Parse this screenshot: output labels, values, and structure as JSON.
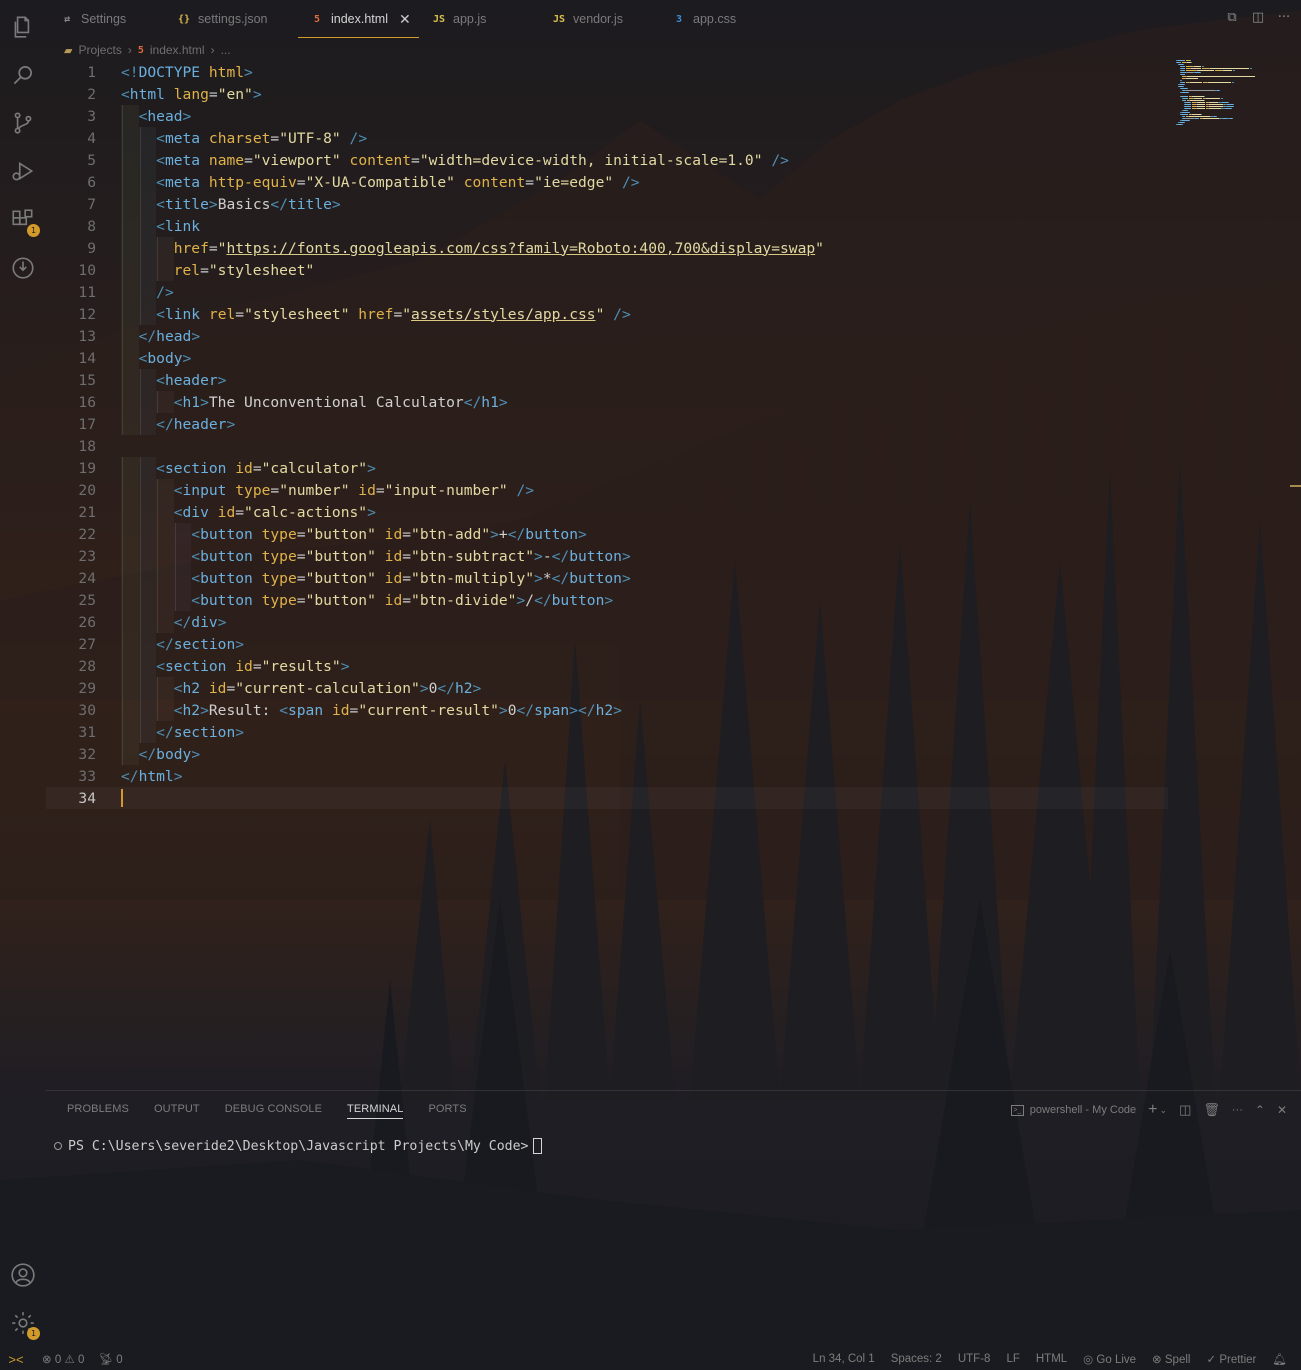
{
  "tabs": [
    {
      "icon": "⇄",
      "label": "Settings",
      "active": false
    },
    {
      "icon": "{}",
      "label": "settings.json",
      "active": false
    },
    {
      "icon": "5",
      "label": "index.html",
      "active": true
    },
    {
      "icon": "JS",
      "label": "app.js",
      "active": false
    },
    {
      "icon": "JS",
      "label": "vendor.js",
      "active": false
    },
    {
      "icon": "3",
      "label": "app.css",
      "active": false
    }
  ],
  "tab_close_glyph": "✕",
  "top_actions": [
    "⧉",
    "◫",
    "···"
  ],
  "breadcrumb": {
    "folder": "Projects",
    "sep": "›",
    "file": "index.html",
    "sep2": "›",
    "more": "..."
  },
  "code_lines": [
    {
      "n": "1",
      "c": [
        [
          "p",
          "<!"
        ],
        [
          "t",
          "DOCTYPE"
        ],
        [
          "x",
          " "
        ],
        [
          "a",
          "html"
        ],
        [
          "p",
          ">"
        ]
      ]
    },
    {
      "n": "2",
      "c": [
        [
          "p",
          "<"
        ],
        [
          "t",
          "html"
        ],
        [
          "x",
          " "
        ],
        [
          "a",
          "lang"
        ],
        [
          "x",
          "="
        ],
        [
          "s",
          "\"en\""
        ],
        [
          "p",
          ">"
        ]
      ]
    },
    {
      "n": "3",
      "c": [
        [
          "x",
          "  "
        ],
        [
          "p",
          "<"
        ],
        [
          "t",
          "head"
        ],
        [
          "p",
          ">"
        ]
      ]
    },
    {
      "n": "4",
      "c": [
        [
          "x",
          "    "
        ],
        [
          "p",
          "<"
        ],
        [
          "t",
          "meta"
        ],
        [
          "x",
          " "
        ],
        [
          "a",
          "charset"
        ],
        [
          "x",
          "="
        ],
        [
          "s",
          "\"UTF-8\""
        ],
        [
          "x",
          " "
        ],
        [
          "p",
          "/>"
        ]
      ]
    },
    {
      "n": "5",
      "c": [
        [
          "x",
          "    "
        ],
        [
          "p",
          "<"
        ],
        [
          "t",
          "meta"
        ],
        [
          "x",
          " "
        ],
        [
          "a",
          "name"
        ],
        [
          "x",
          "="
        ],
        [
          "s",
          "\"viewport\""
        ],
        [
          "x",
          " "
        ],
        [
          "a",
          "content"
        ],
        [
          "x",
          "="
        ],
        [
          "s",
          "\"width=device-width, initial-scale=1.0\""
        ],
        [
          "x",
          " "
        ],
        [
          "p",
          "/>"
        ]
      ]
    },
    {
      "n": "6",
      "c": [
        [
          "x",
          "    "
        ],
        [
          "p",
          "<"
        ],
        [
          "t",
          "meta"
        ],
        [
          "x",
          " "
        ],
        [
          "a",
          "http-equiv"
        ],
        [
          "x",
          "="
        ],
        [
          "s",
          "\"X-UA-Compatible\""
        ],
        [
          "x",
          " "
        ],
        [
          "a",
          "content"
        ],
        [
          "x",
          "="
        ],
        [
          "s",
          "\"ie=edge\""
        ],
        [
          "x",
          " "
        ],
        [
          "p",
          "/>"
        ]
      ]
    },
    {
      "n": "7",
      "c": [
        [
          "x",
          "    "
        ],
        [
          "p",
          "<"
        ],
        [
          "t",
          "title"
        ],
        [
          "p",
          ">"
        ],
        [
          "x",
          "Basics"
        ],
        [
          "p",
          "</"
        ],
        [
          "t",
          "title"
        ],
        [
          "p",
          ">"
        ]
      ]
    },
    {
      "n": "8",
      "c": [
        [
          "x",
          "    "
        ],
        [
          "p",
          "<"
        ],
        [
          "t",
          "link"
        ]
      ]
    },
    {
      "n": "9",
      "c": [
        [
          "x",
          "      "
        ],
        [
          "a",
          "href"
        ],
        [
          "x",
          "="
        ],
        [
          "s",
          "\""
        ],
        [
          "su",
          "https://fonts.googleapis.com/css?family=Roboto:400,700&display=swap"
        ],
        [
          "s",
          "\""
        ]
      ]
    },
    {
      "n": "10",
      "c": [
        [
          "x",
          "      "
        ],
        [
          "a",
          "rel"
        ],
        [
          "x",
          "="
        ],
        [
          "s",
          "\"stylesheet\""
        ]
      ]
    },
    {
      "n": "11",
      "c": [
        [
          "x",
          "    "
        ],
        [
          "p",
          "/>"
        ]
      ]
    },
    {
      "n": "12",
      "c": [
        [
          "x",
          "    "
        ],
        [
          "p",
          "<"
        ],
        [
          "t",
          "link"
        ],
        [
          "x",
          " "
        ],
        [
          "a",
          "rel"
        ],
        [
          "x",
          "="
        ],
        [
          "s",
          "\"stylesheet\""
        ],
        [
          "x",
          " "
        ],
        [
          "a",
          "href"
        ],
        [
          "x",
          "="
        ],
        [
          "s",
          "\""
        ],
        [
          "su",
          "assets/styles/app.css"
        ],
        [
          "s",
          "\""
        ],
        [
          "x",
          " "
        ],
        [
          "p",
          "/>"
        ]
      ]
    },
    {
      "n": "13",
      "c": [
        [
          "x",
          "  "
        ],
        [
          "p",
          "</"
        ],
        [
          "t",
          "head"
        ],
        [
          "p",
          ">"
        ]
      ]
    },
    {
      "n": "14",
      "c": [
        [
          "x",
          "  "
        ],
        [
          "p",
          "<"
        ],
        [
          "t",
          "body"
        ],
        [
          "p",
          ">"
        ]
      ]
    },
    {
      "n": "15",
      "c": [
        [
          "x",
          "    "
        ],
        [
          "p",
          "<"
        ],
        [
          "t",
          "header"
        ],
        [
          "p",
          ">"
        ]
      ]
    },
    {
      "n": "16",
      "c": [
        [
          "x",
          "      "
        ],
        [
          "p",
          "<"
        ],
        [
          "t",
          "h1"
        ],
        [
          "p",
          ">"
        ],
        [
          "x",
          "The Unconventional Calculator"
        ],
        [
          "p",
          "</"
        ],
        [
          "t",
          "h1"
        ],
        [
          "p",
          ">"
        ]
      ]
    },
    {
      "n": "17",
      "c": [
        [
          "x",
          "    "
        ],
        [
          "p",
          "</"
        ],
        [
          "t",
          "header"
        ],
        [
          "p",
          ">"
        ]
      ]
    },
    {
      "n": "18",
      "c": []
    },
    {
      "n": "19",
      "c": [
        [
          "x",
          "    "
        ],
        [
          "p",
          "<"
        ],
        [
          "t",
          "section"
        ],
        [
          "x",
          " "
        ],
        [
          "a",
          "id"
        ],
        [
          "x",
          "="
        ],
        [
          "s",
          "\"calculator\""
        ],
        [
          "p",
          ">"
        ]
      ]
    },
    {
      "n": "20",
      "c": [
        [
          "x",
          "      "
        ],
        [
          "p",
          "<"
        ],
        [
          "t",
          "input"
        ],
        [
          "x",
          " "
        ],
        [
          "a",
          "type"
        ],
        [
          "x",
          "="
        ],
        [
          "s",
          "\"number\""
        ],
        [
          "x",
          " "
        ],
        [
          "a",
          "id"
        ],
        [
          "x",
          "="
        ],
        [
          "s",
          "\"input-number\""
        ],
        [
          "x",
          " "
        ],
        [
          "p",
          "/>"
        ]
      ]
    },
    {
      "n": "21",
      "c": [
        [
          "x",
          "      "
        ],
        [
          "p",
          "<"
        ],
        [
          "t",
          "div"
        ],
        [
          "x",
          " "
        ],
        [
          "a",
          "id"
        ],
        [
          "x",
          "="
        ],
        [
          "s",
          "\"calc-actions\""
        ],
        [
          "p",
          ">"
        ]
      ]
    },
    {
      "n": "22",
      "c": [
        [
          "x",
          "        "
        ],
        [
          "p",
          "<"
        ],
        [
          "t",
          "button"
        ],
        [
          "x",
          " "
        ],
        [
          "a",
          "type"
        ],
        [
          "x",
          "="
        ],
        [
          "s",
          "\"button\""
        ],
        [
          "x",
          " "
        ],
        [
          "a",
          "id"
        ],
        [
          "x",
          "="
        ],
        [
          "s",
          "\"btn-add\""
        ],
        [
          "p",
          ">"
        ],
        [
          "x",
          "+"
        ],
        [
          "p",
          "</"
        ],
        [
          "t",
          "button"
        ],
        [
          "p",
          ">"
        ]
      ]
    },
    {
      "n": "23",
      "c": [
        [
          "x",
          "        "
        ],
        [
          "p",
          "<"
        ],
        [
          "t",
          "button"
        ],
        [
          "x",
          " "
        ],
        [
          "a",
          "type"
        ],
        [
          "x",
          "="
        ],
        [
          "s",
          "\"button\""
        ],
        [
          "x",
          " "
        ],
        [
          "a",
          "id"
        ],
        [
          "x",
          "="
        ],
        [
          "s",
          "\"btn-subtract\""
        ],
        [
          "p",
          ">"
        ],
        [
          "x",
          "-"
        ],
        [
          "p",
          "</"
        ],
        [
          "t",
          "button"
        ],
        [
          "p",
          ">"
        ]
      ]
    },
    {
      "n": "24",
      "c": [
        [
          "x",
          "        "
        ],
        [
          "p",
          "<"
        ],
        [
          "t",
          "button"
        ],
        [
          "x",
          " "
        ],
        [
          "a",
          "type"
        ],
        [
          "x",
          "="
        ],
        [
          "s",
          "\"button\""
        ],
        [
          "x",
          " "
        ],
        [
          "a",
          "id"
        ],
        [
          "x",
          "="
        ],
        [
          "s",
          "\"btn-multiply\""
        ],
        [
          "p",
          ">"
        ],
        [
          "x",
          "*"
        ],
        [
          "p",
          "</"
        ],
        [
          "t",
          "button"
        ],
        [
          "p",
          ">"
        ]
      ]
    },
    {
      "n": "25",
      "c": [
        [
          "x",
          "        "
        ],
        [
          "p",
          "<"
        ],
        [
          "t",
          "button"
        ],
        [
          "x",
          " "
        ],
        [
          "a",
          "type"
        ],
        [
          "x",
          "="
        ],
        [
          "s",
          "\"button\""
        ],
        [
          "x",
          " "
        ],
        [
          "a",
          "id"
        ],
        [
          "x",
          "="
        ],
        [
          "s",
          "\"btn-divide\""
        ],
        [
          "p",
          ">"
        ],
        [
          "x",
          "/"
        ],
        [
          "p",
          "</"
        ],
        [
          "t",
          "button"
        ],
        [
          "p",
          ">"
        ]
      ]
    },
    {
      "n": "26",
      "c": [
        [
          "x",
          "      "
        ],
        [
          "p",
          "</"
        ],
        [
          "t",
          "div"
        ],
        [
          "p",
          ">"
        ]
      ]
    },
    {
      "n": "27",
      "c": [
        [
          "x",
          "    "
        ],
        [
          "p",
          "</"
        ],
        [
          "t",
          "section"
        ],
        [
          "p",
          ">"
        ]
      ]
    },
    {
      "n": "28",
      "c": [
        [
          "x",
          "    "
        ],
        [
          "p",
          "<"
        ],
        [
          "t",
          "section"
        ],
        [
          "x",
          " "
        ],
        [
          "a",
          "id"
        ],
        [
          "x",
          "="
        ],
        [
          "s",
          "\"results\""
        ],
        [
          "p",
          ">"
        ]
      ]
    },
    {
      "n": "29",
      "c": [
        [
          "x",
          "      "
        ],
        [
          "p",
          "<"
        ],
        [
          "t",
          "h2"
        ],
        [
          "x",
          " "
        ],
        [
          "a",
          "id"
        ],
        [
          "x",
          "="
        ],
        [
          "s",
          "\"current-calculation\""
        ],
        [
          "p",
          ">"
        ],
        [
          "x",
          "0"
        ],
        [
          "p",
          "</"
        ],
        [
          "t",
          "h2"
        ],
        [
          "p",
          ">"
        ]
      ]
    },
    {
      "n": "30",
      "c": [
        [
          "x",
          "      "
        ],
        [
          "p",
          "<"
        ],
        [
          "t",
          "h2"
        ],
        [
          "p",
          ">"
        ],
        [
          "x",
          "Result: "
        ],
        [
          "p",
          "<"
        ],
        [
          "t",
          "span"
        ],
        [
          "x",
          " "
        ],
        [
          "a",
          "id"
        ],
        [
          "x",
          "="
        ],
        [
          "s",
          "\"current-result\""
        ],
        [
          "p",
          ">"
        ],
        [
          "x",
          "0"
        ],
        [
          "p",
          "</"
        ],
        [
          "t",
          "span"
        ],
        [
          "p",
          "></"
        ],
        [
          "t",
          "h2"
        ],
        [
          "p",
          ">"
        ]
      ]
    },
    {
      "n": "31",
      "c": [
        [
          "x",
          "    "
        ],
        [
          "p",
          "</"
        ],
        [
          "t",
          "section"
        ],
        [
          "p",
          ">"
        ]
      ]
    },
    {
      "n": "32",
      "c": [
        [
          "x",
          "  "
        ],
        [
          "p",
          "</"
        ],
        [
          "t",
          "body"
        ],
        [
          "p",
          ">"
        ]
      ]
    },
    {
      "n": "33",
      "c": [
        [
          "p",
          "</"
        ],
        [
          "t",
          "html"
        ],
        [
          "p",
          ">"
        ]
      ]
    },
    {
      "n": "34",
      "c": []
    }
  ],
  "current_line": "34",
  "panel": {
    "tabs": [
      "PROBLEMS",
      "OUTPUT",
      "DEBUG CONSOLE",
      "TERMINAL",
      "PORTS"
    ],
    "active_tab": "TERMINAL",
    "terminal_name": "powershell - My Code",
    "terminal_prompt": "PS C:\\Users\\severide2\\Desktop\\Javascript Projects\\My Code>"
  },
  "status": {
    "remote_glyph": "><",
    "errors": "0",
    "warnings": "0",
    "ports": "0",
    "right": [
      "Ln 34, Col 1",
      "Spaces: 2",
      "UTF-8",
      "LF",
      "HTML",
      "Go Live",
      "Spell",
      "Prettier"
    ]
  },
  "badges": {
    "extensions": "1",
    "settings": "1"
  },
  "colors": {
    "accent": "#d19a2a",
    "tag": "#6bb0de",
    "attribute": "#e0b24a",
    "string": "#e3d9a2",
    "punctuation": "#4f8fb4"
  }
}
